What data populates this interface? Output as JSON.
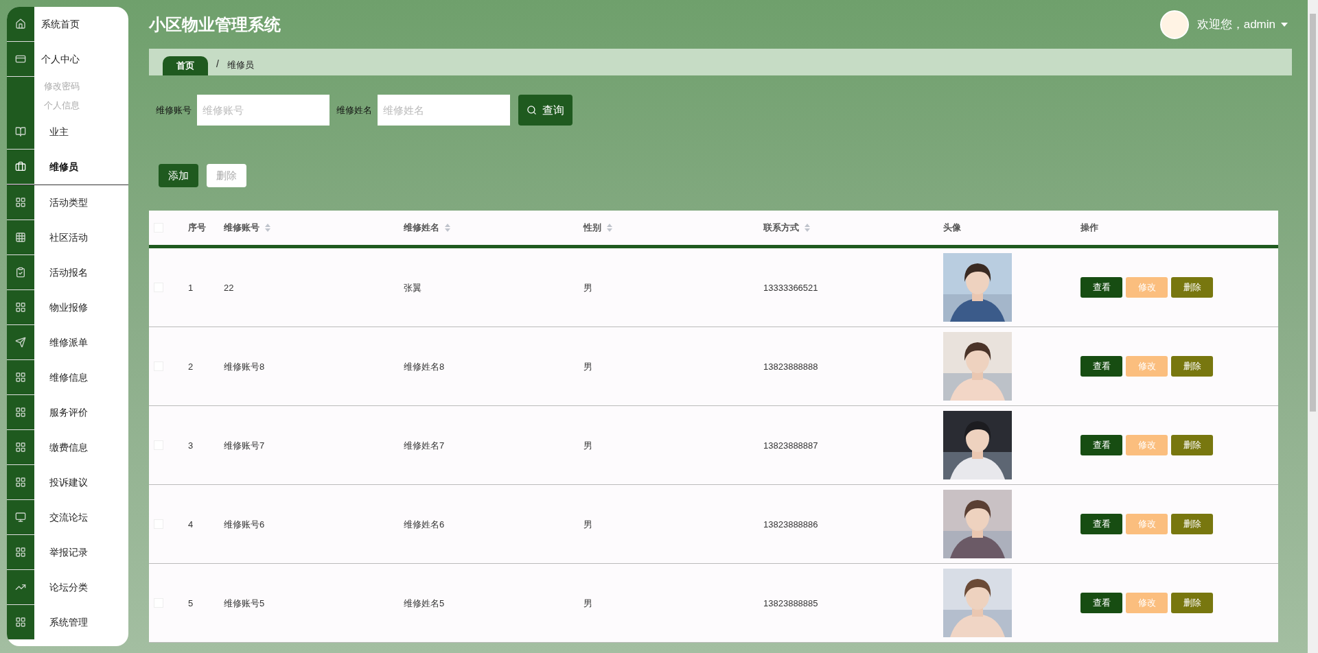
{
  "sidebar": {
    "items": [
      {
        "label": "系统首页",
        "selected": false
      },
      {
        "label": "个人中心",
        "selected": false,
        "children": [
          {
            "label": "修改密码"
          },
          {
            "label": "个人信息"
          }
        ]
      },
      {
        "label": "业主",
        "selected": false
      },
      {
        "label": "维修员",
        "selected": true
      },
      {
        "label": "活动类型",
        "selected": false
      },
      {
        "label": "社区活动",
        "selected": false
      },
      {
        "label": "活动报名",
        "selected": false
      },
      {
        "label": "物业报修",
        "selected": false
      },
      {
        "label": "维修派单",
        "selected": false
      },
      {
        "label": "维修信息",
        "selected": false
      },
      {
        "label": "服务评价",
        "selected": false
      },
      {
        "label": "缴费信息",
        "selected": false
      },
      {
        "label": "投诉建议",
        "selected": false
      },
      {
        "label": "交流论坛",
        "selected": false
      },
      {
        "label": "举报记录",
        "selected": false
      },
      {
        "label": "论坛分类",
        "selected": false
      },
      {
        "label": "系统管理",
        "selected": false
      }
    ]
  },
  "header": {
    "title": "小区物业管理系统",
    "user": "欢迎您，admin"
  },
  "breadcrumb": {
    "separator": "/",
    "items": [
      "首页",
      "维修员"
    ]
  },
  "search": {
    "fields": [
      {
        "label": "维修账号",
        "placeholder": "维修账号"
      },
      {
        "label": "维修姓名",
        "placeholder": "维修姓名"
      }
    ],
    "button": "查询"
  },
  "actions": [
    {
      "label": "添加",
      "disabled": false
    },
    {
      "label": "删除",
      "disabled": true
    }
  ],
  "table": {
    "select_all_checked": false,
    "columns": [
      {
        "label": "序号",
        "sortable": false
      },
      {
        "label": "维修账号",
        "sortable": true
      },
      {
        "label": "维修姓名",
        "sortable": true
      },
      {
        "label": "性别",
        "sortable": true
      },
      {
        "label": "联系方式",
        "sortable": true
      },
      {
        "label": "头像",
        "sortable": false
      },
      {
        "label": "操作",
        "sortable": false
      }
    ],
    "rows": [
      {
        "checked": false,
        "cells": [
          "1",
          "22",
          "张翼",
          "男",
          "13333366521"
        ],
        "buttons": [
          "查看",
          "修改",
          "删除"
        ]
      },
      {
        "checked": false,
        "cells": [
          "2",
          "维修账号8",
          "维修姓名8",
          "男",
          "13823888888"
        ],
        "buttons": [
          "查看",
          "修改",
          "删除"
        ]
      },
      {
        "checked": false,
        "cells": [
          "3",
          "维修账号7",
          "维修姓名7",
          "男",
          "13823888887"
        ],
        "buttons": [
          "查看",
          "修改",
          "删除"
        ]
      },
      {
        "checked": false,
        "cells": [
          "4",
          "维修账号6",
          "维修姓名6",
          "男",
          "13823888886"
        ],
        "buttons": [
          "查看",
          "修改",
          "删除"
        ]
      },
      {
        "checked": false,
        "cells": [
          "5",
          "维修账号5",
          "维修姓名5",
          "男",
          "13823888885"
        ],
        "buttons": [
          "查看",
          "修改",
          "删除"
        ]
      }
    ]
  }
}
